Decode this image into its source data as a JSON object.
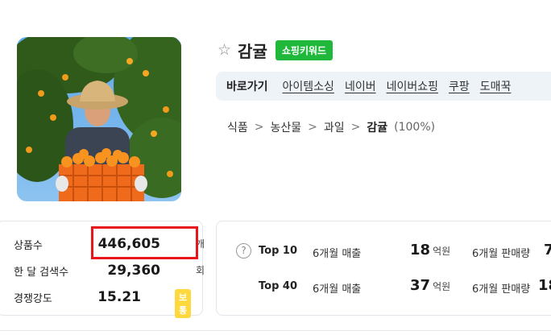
{
  "product": {
    "title": "감귤",
    "badge": "쇼핑키워드",
    "image_alt": "photo of a farmer holding an orange crate of tangerines in an orchard"
  },
  "icons": {
    "star": "star-outline-icon",
    "help": "question-circle-icon"
  },
  "shortcuts": {
    "title": "바로가기",
    "links": [
      "아이템소싱",
      "네이버",
      "네이버쇼핑",
      "쿠팡",
      "도매꾹"
    ]
  },
  "breadcrumb": {
    "items": [
      "식품",
      "농산물",
      "과일"
    ],
    "current": "감귤",
    "percent": "(100%)"
  },
  "stats": {
    "product_count": {
      "label": "상품수",
      "value": "446,605",
      "unit": "개"
    },
    "monthly_search": {
      "label": "한 달 검색수",
      "value": "29,360",
      "unit": "회"
    },
    "competition": {
      "label": "경쟁강도",
      "value": "15.21",
      "level": "보통"
    }
  },
  "ranking": {
    "rows": [
      {
        "label": "Top 10",
        "sales_label": "6개월 매출",
        "sales_value": "18",
        "sales_unit": "억원",
        "volume_label": "6개월 판매량",
        "volume_value": "7"
      },
      {
        "label": "Top 40",
        "sales_label": "6개월 매출",
        "sales_value": "37",
        "sales_unit": "억원",
        "volume_label": "6개월 판매량",
        "volume_value": "18"
      }
    ]
  },
  "colors": {
    "badge_green": "#1fb83a",
    "highlight_red": "#e8161a",
    "level_yellow": "#ffd83d",
    "shortcut_bg": "#eef3f8"
  }
}
